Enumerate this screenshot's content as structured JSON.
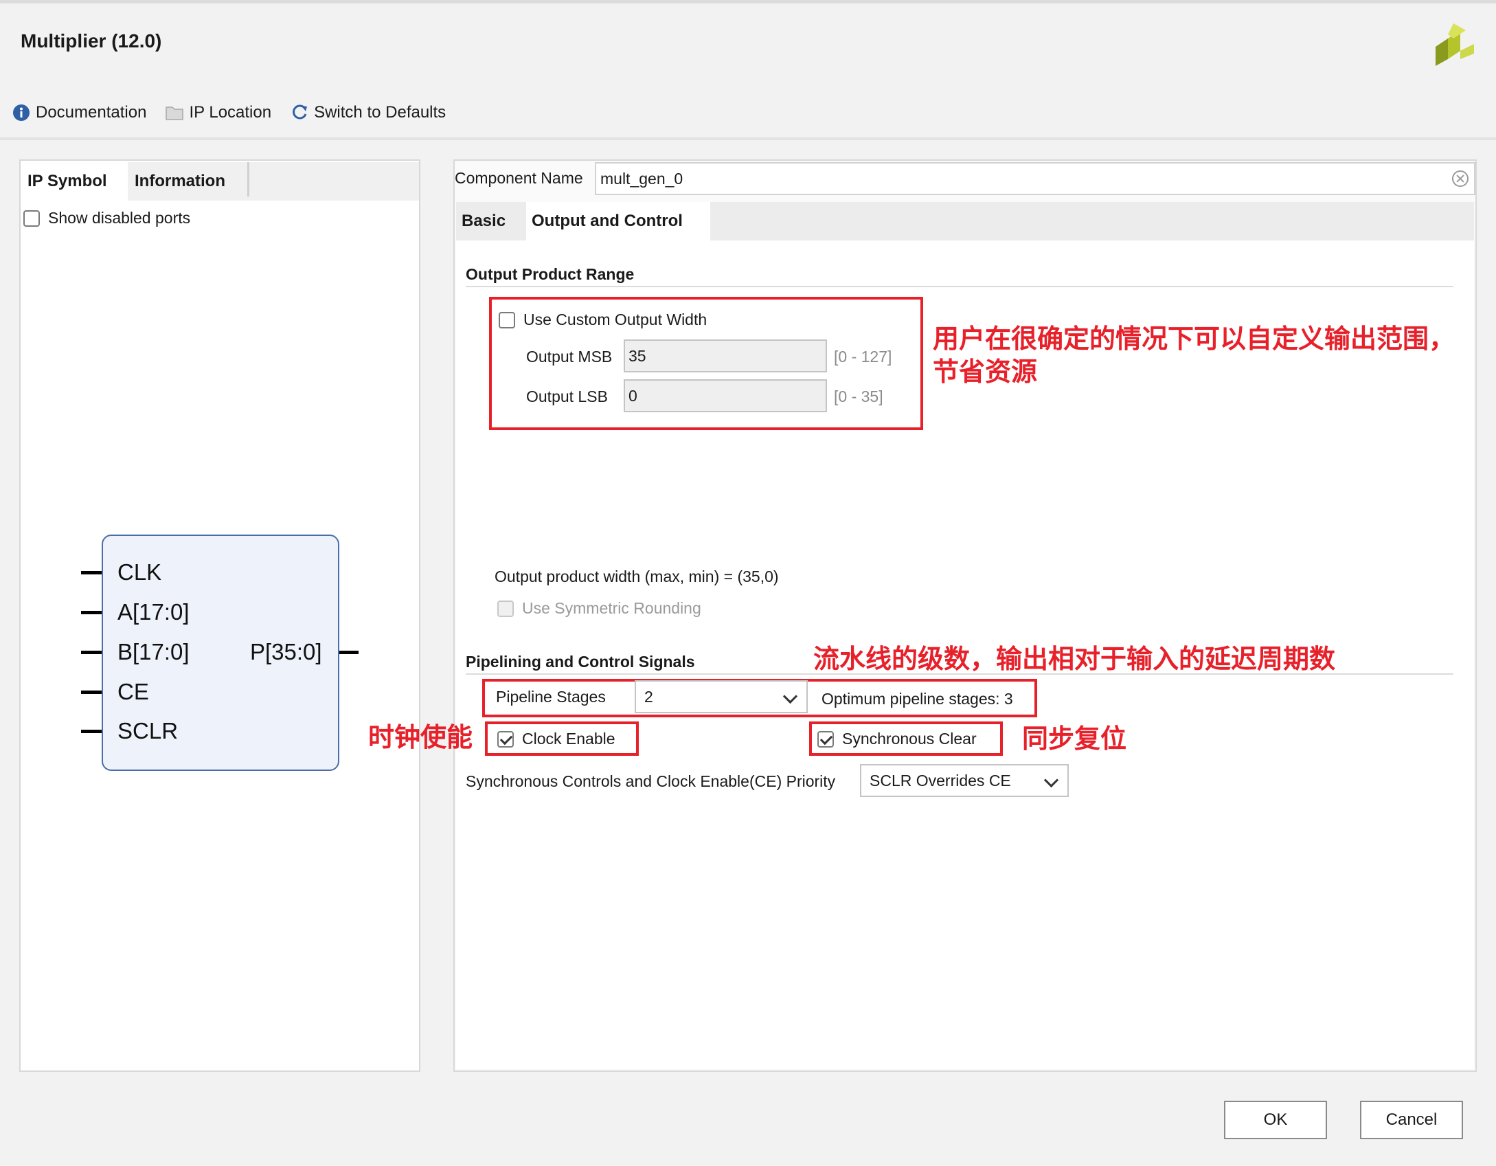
{
  "window": {
    "title": "Multiplier (12.0)"
  },
  "toolbar": {
    "documentation": "Documentation",
    "ip_location": "IP Location",
    "switch_defaults": "Switch to Defaults"
  },
  "left": {
    "tabs": [
      "IP Symbol",
      "Information"
    ],
    "show_disabled_ports": "Show disabled ports",
    "symbol": {
      "inputs": [
        "CLK",
        "A[17:0]",
        "B[17:0]",
        "CE",
        "SCLR"
      ],
      "output": "P[35:0]"
    }
  },
  "right": {
    "component_name_label": "Component Name",
    "component_name_value": "mult_gen_0",
    "tabs": [
      "Basic",
      "Output and Control"
    ],
    "output_range": {
      "title": "Output Product Range",
      "use_custom_width": "Use Custom Output Width",
      "msb_label": "Output MSB",
      "msb_value": "35",
      "msb_range": "[0 - 127]",
      "lsb_label": "Output LSB",
      "lsb_value": "0",
      "lsb_range": "[0 - 35]",
      "width_text": "Output product width (max, min) = (35,0)",
      "symmetric_rounding": "Use Symmetric Rounding"
    },
    "pipelining": {
      "title": "Pipelining and Control Signals",
      "stages_label": "Pipeline Stages",
      "stages_value": "2",
      "optimum_text": "Optimum pipeline stages: 3",
      "clock_enable": "Clock Enable",
      "sync_clear": "Synchronous Clear",
      "priority_label": "Synchronous Controls and Clock Enable(CE) Priority",
      "priority_value": "SCLR Overrides CE"
    }
  },
  "annotations": {
    "custom_width_note_line1": "用户在很确定的情况下可以自定义输出范围，",
    "custom_width_note_line2": "节省资源",
    "pipeline_note": "流水线的级数，输出相对于输入的延迟周期数",
    "clock_enable_note": "时钟使能",
    "sync_clear_note": "同步复位",
    "color": "#e8202a"
  },
  "buttons": {
    "ok": "OK",
    "cancel": "Cancel"
  }
}
